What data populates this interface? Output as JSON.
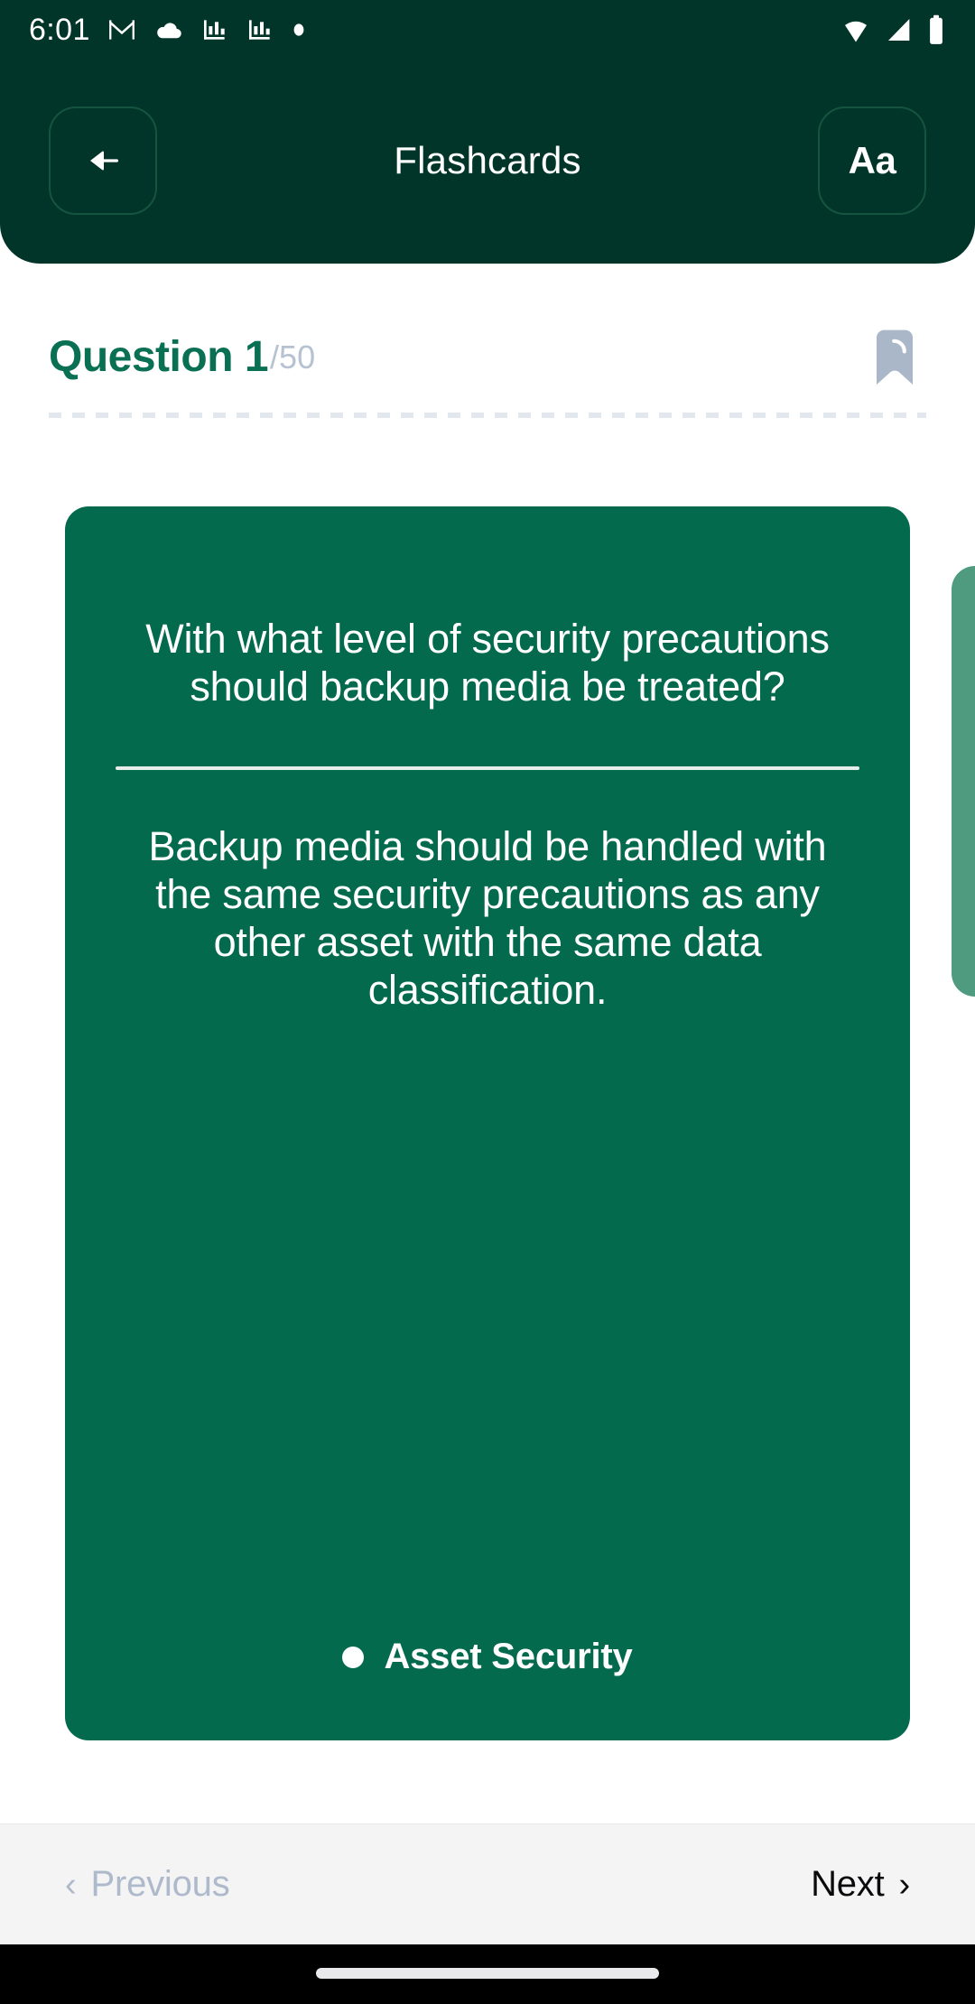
{
  "status_bar": {
    "time": "6:01",
    "left_icons": [
      "gmail-icon",
      "cloud-icon",
      "chart-bars-icon",
      "chart-bars-icon",
      "dot-icon"
    ],
    "right_icons": [
      "wifi-icon",
      "cellular-signal-icon",
      "battery-icon"
    ]
  },
  "header": {
    "title": "Flashcards",
    "back_icon": "arrow-left-icon",
    "font_size_label": "Aa",
    "background_color": "#02352A"
  },
  "question_meta": {
    "question_label": "Question 1",
    "total_label": "/50",
    "question_number": 1,
    "total_questions": 50,
    "bookmark_icon": "bookmark-icon",
    "accent_color": "#0A7053",
    "muted_color": "#B6C2D2"
  },
  "card": {
    "question": "With what level of security precautions should backup media be treated?",
    "answer": "Backup media should be handled with the same security precautions as any other asset with the same data classification.",
    "category": "Asset Security",
    "card_color": "#046A4E",
    "next_card_color": "#4E9B80"
  },
  "footer": {
    "previous_label": "Previous",
    "previous_chevron": "‹",
    "previous_enabled": false,
    "next_label": "Next",
    "next_chevron": "›",
    "next_enabled": true,
    "disabled_color": "#AEBACB",
    "enabled_color": "#0B0B0D"
  }
}
